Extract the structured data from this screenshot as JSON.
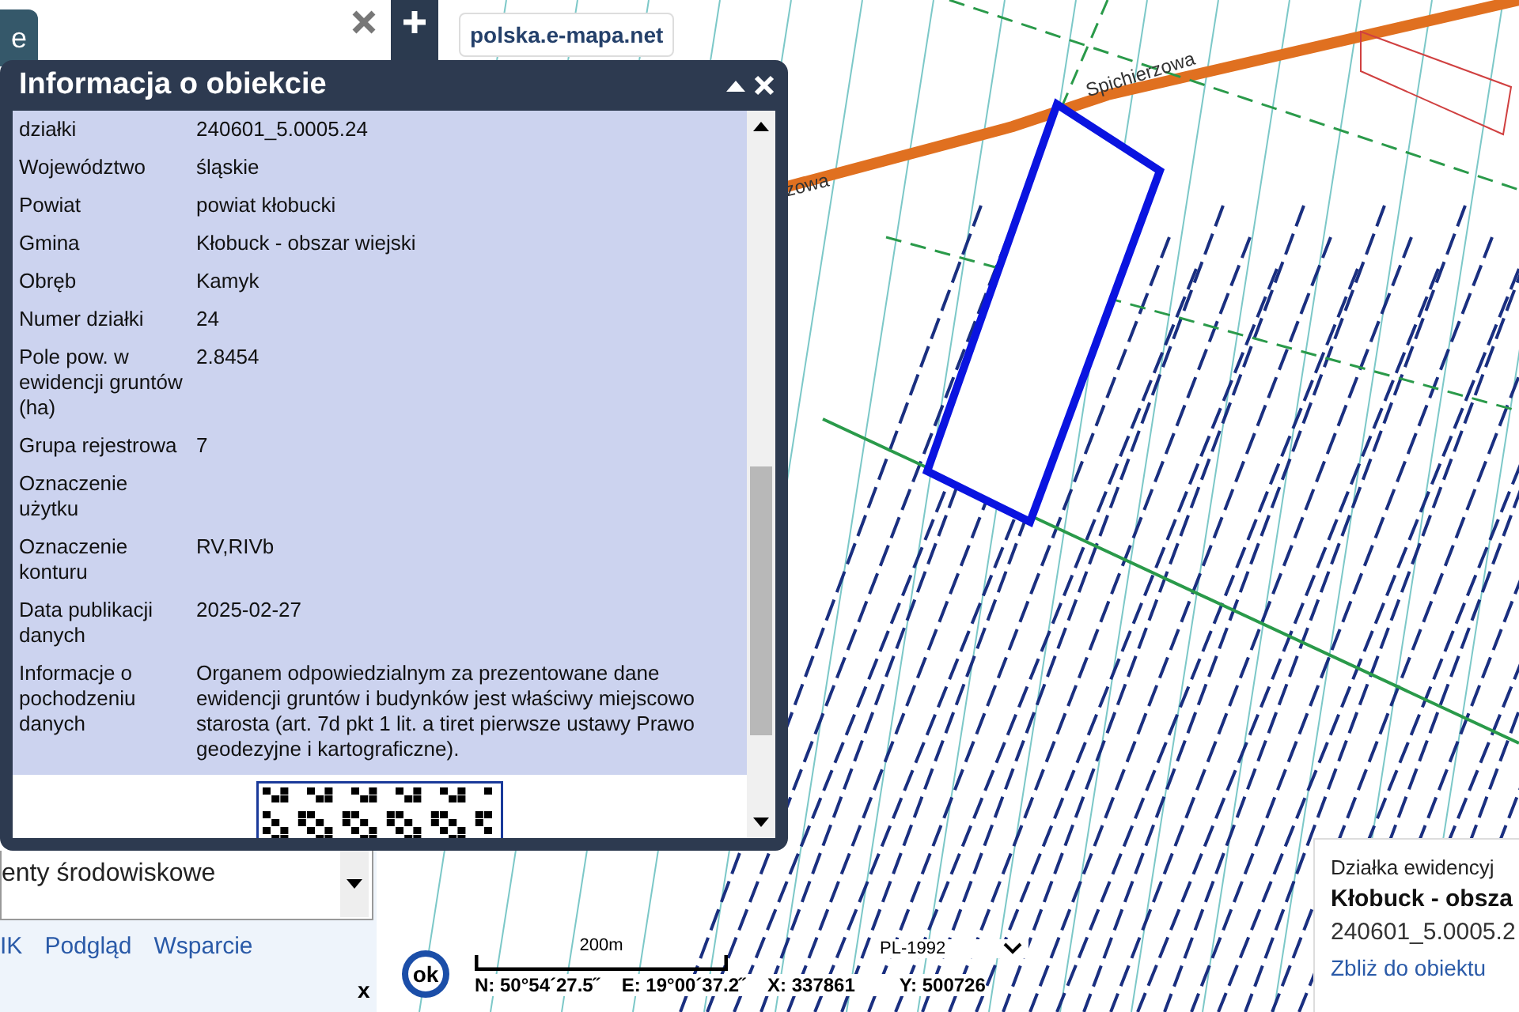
{
  "map": {
    "source_label": "polska.e-mapa.net",
    "road_labels": [
      "Spichierzowa",
      "zowa"
    ]
  },
  "popup": {
    "title": "Informacja o obiekcie",
    "rows": [
      {
        "label": "działki",
        "value": "240601_5.0005.24"
      },
      {
        "label": "Województwo",
        "value": "śląskie"
      },
      {
        "label": "Powiat",
        "value": "powiat kłobucki"
      },
      {
        "label": "Gmina",
        "value": "Kłobuck - obszar wiejski"
      },
      {
        "label": "Obręb",
        "value": "Kamyk"
      },
      {
        "label": "Numer działki",
        "value": "24"
      },
      {
        "label": "Pole pow. w ewidencji gruntów (ha)",
        "value": "2.8454"
      },
      {
        "label": "Grupa rejestrowa",
        "value": "7"
      },
      {
        "label": "Oznaczenie użytku"
      },
      {
        "label": "Oznaczenie konturu",
        "value": "RV,RIVb"
      },
      {
        "label": "Data publikacji danych",
        "value": "2025-02-27"
      },
      {
        "label": "Informacje o pochodzeniu danych",
        "value": "Organem odpowiedzialnym za prezentowane dane ewidencji gruntów i budynków jest właściwy miejscowo starosta (art. 7d pkt 1 lit. a tiret pierwsze ustawy Prawo geodezyjne i kartograficzne)."
      }
    ]
  },
  "side_panel": {
    "tab_fragment": "e",
    "layer_select": "enty środowiskowe",
    "links": [
      "IK",
      "Podgląd",
      "Wsparcie"
    ],
    "close": "x"
  },
  "status_bar": {
    "ok_button": "ok",
    "scale": "200m",
    "n": "N: 50°54´27.5˝",
    "e": "E: 19°00´37.2˝",
    "x": "X: 337861",
    "y": "Y: 500726",
    "crs": "PL-1992"
  },
  "info_card": {
    "type": "Działka ewidencyj",
    "name": "Kłobuck - obsza",
    "id": "240601_5.0005.2",
    "zoom_link": "Zbliż do obiektu"
  }
}
